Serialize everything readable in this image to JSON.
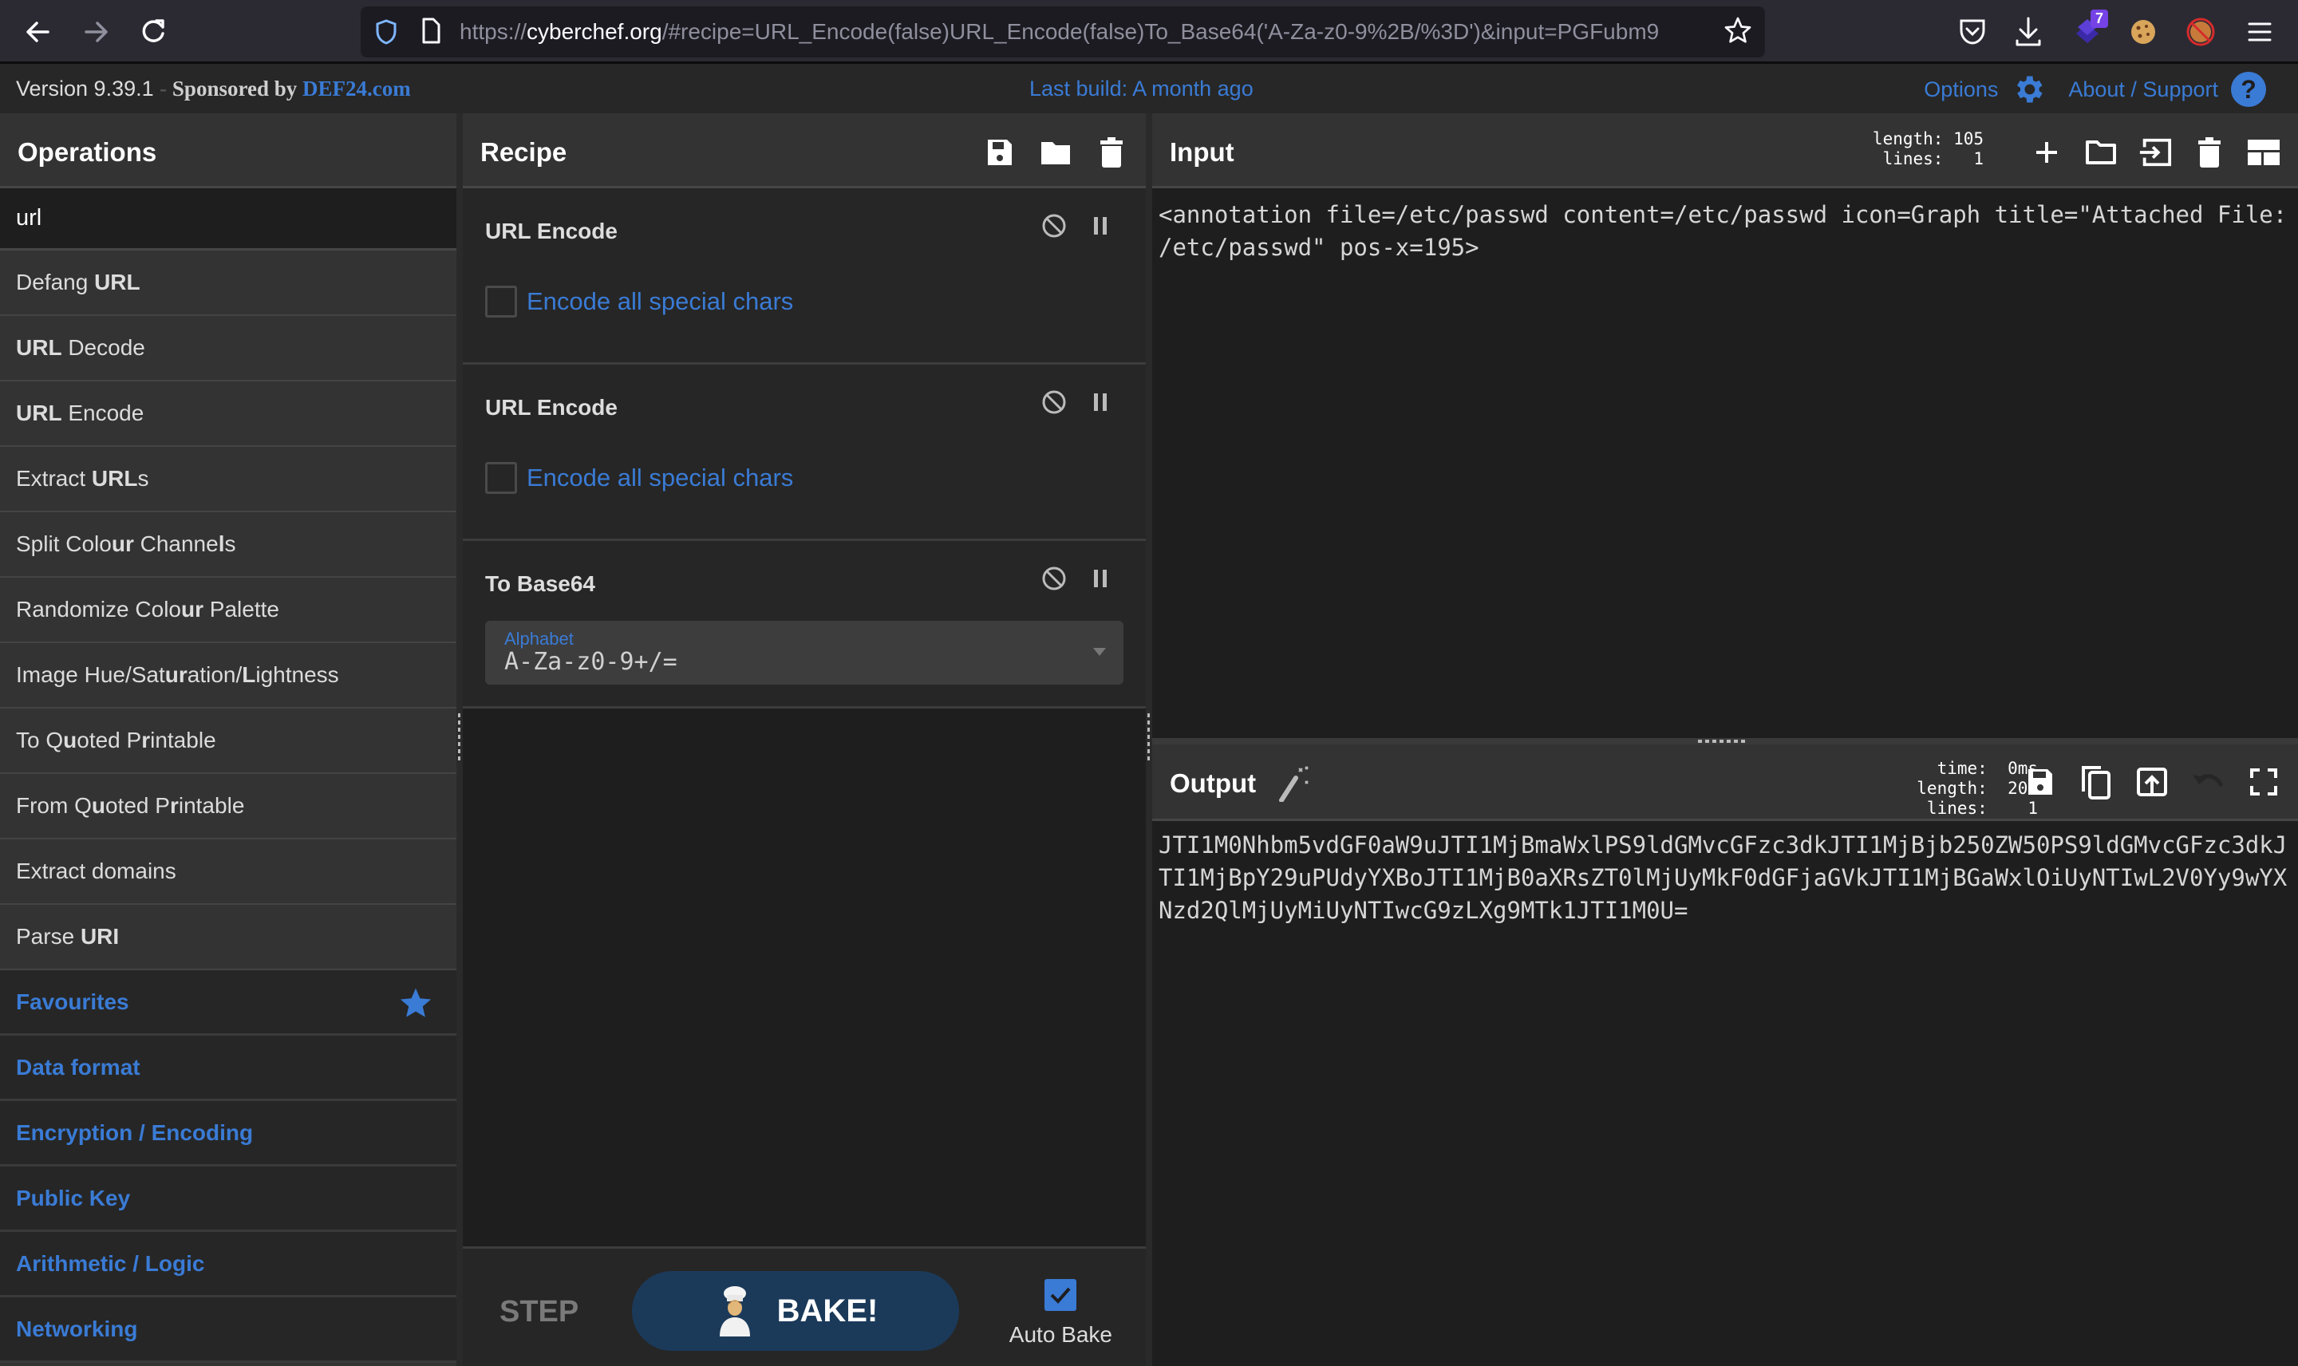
{
  "browser": {
    "url_prefix": "https://",
    "url_host": "cyberchef.org",
    "url_rest": "/#recipe=URL_Encode(false)URL_Encode(false)To_Base64('A-Za-z0-9%2B/%3D')&input=PGFubm9",
    "extension_badge": "7",
    "icons": [
      "back-icon",
      "forward-icon",
      "reload-icon",
      "shield-icon",
      "page-icon",
      "bookmark-star-icon",
      "pocket-icon",
      "download-icon",
      "extension-icon",
      "cookie-icon",
      "blocked-extension-icon",
      "menu-icon"
    ]
  },
  "banner": {
    "version": "Version 9.39.1",
    "sponsored_by": "Sponsored by",
    "sponsor": "DEF24.com",
    "last_build": "Last build: A month ago",
    "options": "Options",
    "about": "About / Support",
    "about_icon": "?"
  },
  "operations": {
    "title": "Operations",
    "search_value": "url",
    "results": [
      {
        "parts": [
          {
            "t": "Defang ",
            "b": false
          },
          {
            "t": "URL",
            "b": true
          }
        ]
      },
      {
        "parts": [
          {
            "t": "URL",
            "b": true
          },
          {
            "t": " Decode",
            "b": false
          }
        ]
      },
      {
        "parts": [
          {
            "t": "URL",
            "b": true
          },
          {
            "t": " Encode",
            "b": false
          }
        ]
      },
      {
        "parts": [
          {
            "t": "Extract ",
            "b": false
          },
          {
            "t": "URL",
            "b": true
          },
          {
            "t": "s",
            "b": false
          }
        ]
      },
      {
        "parts": [
          {
            "t": "Split Colo",
            "b": false
          },
          {
            "t": "ur",
            "b": true
          },
          {
            "t": " Channe",
            "b": false
          },
          {
            "t": "l",
            "b": true
          },
          {
            "t": "s",
            "b": false
          }
        ]
      },
      {
        "parts": [
          {
            "t": "Randomize Colo",
            "b": false
          },
          {
            "t": "ur",
            "b": true
          },
          {
            "t": " Palette",
            "b": false
          }
        ]
      },
      {
        "parts": [
          {
            "t": "Image Hue/Sat",
            "b": false
          },
          {
            "t": "ur",
            "b": true
          },
          {
            "t": "ation/",
            "b": false
          },
          {
            "t": "L",
            "b": true
          },
          {
            "t": "ightness",
            "b": false
          }
        ]
      },
      {
        "parts": [
          {
            "t": "To Q",
            "b": false
          },
          {
            "t": "u",
            "b": true
          },
          {
            "t": "oted P",
            "b": false
          },
          {
            "t": "r",
            "b": true
          },
          {
            "t": "inta",
            "b": false
          },
          {
            "t": "bl",
            "b": false
          },
          {
            "t": "e",
            "b": false
          }
        ]
      },
      {
        "parts": [
          {
            "t": "From Q",
            "b": false
          },
          {
            "t": "u",
            "b": true
          },
          {
            "t": "oted P",
            "b": false
          },
          {
            "t": "r",
            "b": true
          },
          {
            "t": "inta",
            "b": false
          },
          {
            "t": "bl",
            "b": false
          },
          {
            "t": "e",
            "b": false
          }
        ]
      },
      {
        "parts": [
          {
            "t": "Extract domains",
            "b": false
          }
        ]
      },
      {
        "parts": [
          {
            "t": "Parse ",
            "b": false
          },
          {
            "t": "URI",
            "b": true
          }
        ]
      }
    ],
    "categories": [
      "Favourites",
      "Data format",
      "Encryption / Encoding",
      "Public Key",
      "Arithmetic / Logic",
      "Networking"
    ]
  },
  "recipe": {
    "title": "Recipe",
    "operations": [
      {
        "name": "URL Encode",
        "arg_label": "Encode all special chars",
        "checked": false
      },
      {
        "name": "URL Encode",
        "arg_label": "Encode all special chars",
        "checked": false
      },
      {
        "name": "To Base64",
        "select_label": "Alphabet",
        "select_value": "A-Za-z0-9+/="
      }
    ],
    "step": "STEP",
    "bake": "BAKE!",
    "auto_bake": "Auto Bake",
    "auto_bake_checked": true
  },
  "input": {
    "title": "Input",
    "stats": "length: 105\n lines:   1",
    "text": "<annotation file=/etc/passwd content=/etc/passwd icon=Graph title=\"Attached File: /etc/passwd\" pos-x=195>"
  },
  "output": {
    "title": "Output",
    "stats": "  time:  0ms\nlength:  200\n lines:    1",
    "text": "JTI1M0Nhbm5vdGF0aW9uJTI1MjBmaWxlPS9ldGMvcGFzc3dkJTI1MjBjb250ZW50PS9ldGMvcGFzc3dkJTI1MjBpY29uPUdyYXBoJTI1MjB0aXRsZT0lMjUyMkF0dGFjaGVkJTI1MjBGaWxlOiUyNTIwL2V0Yy9wYXNzd2QlMjUyMiUyNTIwcG9zLXg9MTk1JTI1M0U="
  },
  "colors": {
    "accent": "#3a7bd5",
    "bake_button": "#1b3a5a",
    "panel_bg": "#333333",
    "dark_bg": "#1e1e1e"
  }
}
